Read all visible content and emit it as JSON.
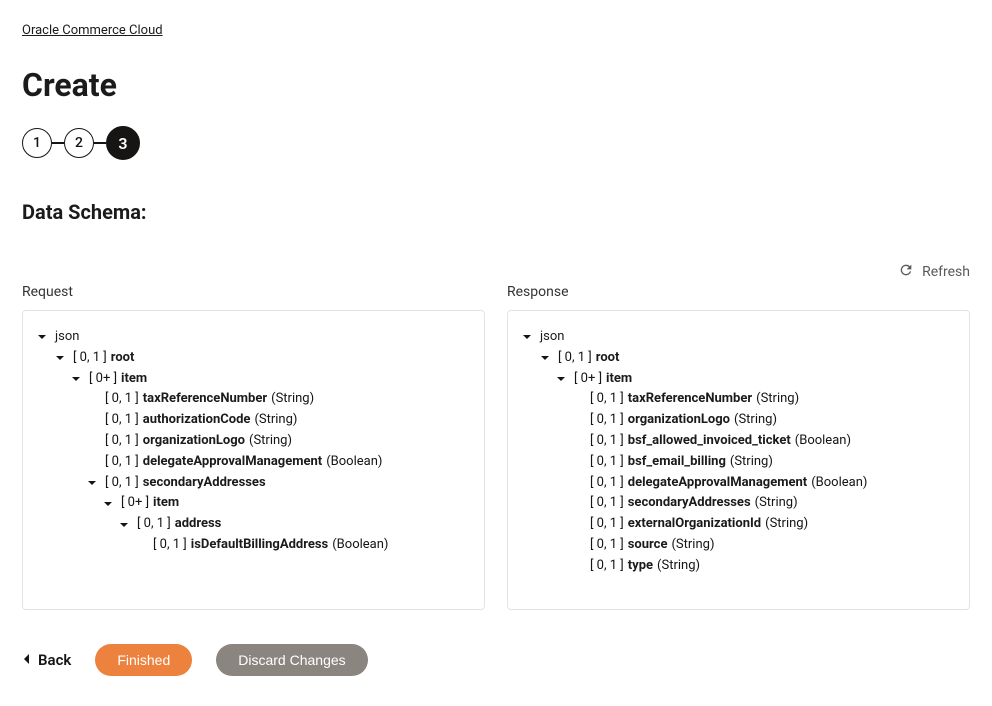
{
  "breadcrumb": "Oracle Commerce Cloud",
  "pageTitle": "Create",
  "stepper": {
    "steps": [
      "1",
      "2",
      "3"
    ],
    "activeIndex": 2
  },
  "sectionTitle": "Data Schema:",
  "refreshLabel": "Refresh",
  "columns": {
    "request": {
      "label": "Request",
      "rootLabel": "json",
      "tree": [
        {
          "indent": 0,
          "expandable": true,
          "prefix": "[ 0, 1 ]",
          "name": "root",
          "type": ""
        },
        {
          "indent": 1,
          "expandable": true,
          "prefix": "[ 0+ ]",
          "name": "item",
          "type": ""
        },
        {
          "indent": 2,
          "expandable": false,
          "prefix": "[ 0, 1 ]",
          "name": "taxReferenceNumber",
          "type": "(String)"
        },
        {
          "indent": 2,
          "expandable": false,
          "prefix": "[ 0, 1 ]",
          "name": "authorizationCode",
          "type": "(String)"
        },
        {
          "indent": 2,
          "expandable": false,
          "prefix": "[ 0, 1 ]",
          "name": "organizationLogo",
          "type": "(String)"
        },
        {
          "indent": 2,
          "expandable": false,
          "prefix": "[ 0, 1 ]",
          "name": "delegateApprovalManagement",
          "type": "(Boolean)"
        },
        {
          "indent": 2,
          "expandable": true,
          "prefix": "[ 0, 1 ]",
          "name": "secondaryAddresses",
          "type": ""
        },
        {
          "indent": 3,
          "expandable": true,
          "prefix": "[ 0+ ]",
          "name": "item",
          "type": ""
        },
        {
          "indent": 4,
          "expandable": true,
          "prefix": "[ 0, 1 ]",
          "name": "address",
          "type": ""
        },
        {
          "indent": 5,
          "expandable": false,
          "prefix": "[ 0, 1 ]",
          "name": "isDefaultBillingAddress",
          "type": "(Boolean)"
        }
      ]
    },
    "response": {
      "label": "Response",
      "rootLabel": "json",
      "tree": [
        {
          "indent": 0,
          "expandable": true,
          "prefix": "[ 0, 1 ]",
          "name": "root",
          "type": ""
        },
        {
          "indent": 1,
          "expandable": true,
          "prefix": "[ 0+ ]",
          "name": "item",
          "type": ""
        },
        {
          "indent": 2,
          "expandable": false,
          "prefix": "[ 0, 1 ]",
          "name": "taxReferenceNumber",
          "type": "(String)"
        },
        {
          "indent": 2,
          "expandable": false,
          "prefix": "[ 0, 1 ]",
          "name": "organizationLogo",
          "type": "(String)"
        },
        {
          "indent": 2,
          "expandable": false,
          "prefix": "[ 0, 1 ]",
          "name": "bsf_allowed_invoiced_ticket",
          "type": "(Boolean)"
        },
        {
          "indent": 2,
          "expandable": false,
          "prefix": "[ 0, 1 ]",
          "name": "bsf_email_billing",
          "type": "(String)"
        },
        {
          "indent": 2,
          "expandable": false,
          "prefix": "[ 0, 1 ]",
          "name": "delegateApprovalManagement",
          "type": "(Boolean)"
        },
        {
          "indent": 2,
          "expandable": false,
          "prefix": "[ 0, 1 ]",
          "name": "secondaryAddresses",
          "type": "(String)"
        },
        {
          "indent": 2,
          "expandable": false,
          "prefix": "[ 0, 1 ]",
          "name": "externalOrganizationId",
          "type": "(String)"
        },
        {
          "indent": 2,
          "expandable": false,
          "prefix": "[ 0, 1 ]",
          "name": "source",
          "type": "(String)"
        },
        {
          "indent": 2,
          "expandable": false,
          "prefix": "[ 0, 1 ]",
          "name": "type",
          "type": "(String)"
        }
      ]
    }
  },
  "footer": {
    "back": "Back",
    "finished": "Finished",
    "discard": "Discard Changes"
  }
}
